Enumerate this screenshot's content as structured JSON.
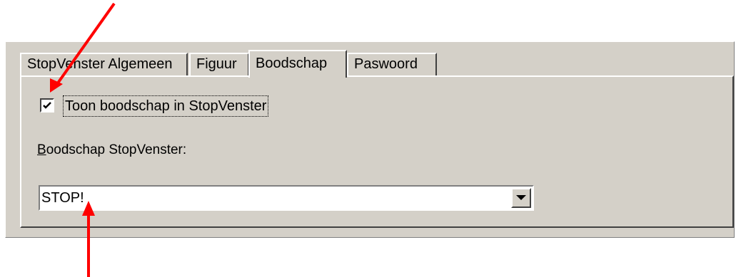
{
  "tabs": [
    {
      "label": "StopVenster Algemeen",
      "active": false
    },
    {
      "label": "Figuur",
      "active": false
    },
    {
      "label": "Boodschap",
      "active": true
    },
    {
      "label": "Paswoord",
      "active": false
    }
  ],
  "checkbox": {
    "label": "Toon boodschap in StopVenster",
    "checked": true
  },
  "message_field": {
    "label": "Boodschap StopVenster:",
    "value": "STOP!"
  },
  "colors": {
    "dialog_bg": "#d4d0c8",
    "annotation_arrow": "#ff0000"
  },
  "icons": {
    "dropdown": "chevron-down-icon",
    "check": "checkmark-icon"
  }
}
